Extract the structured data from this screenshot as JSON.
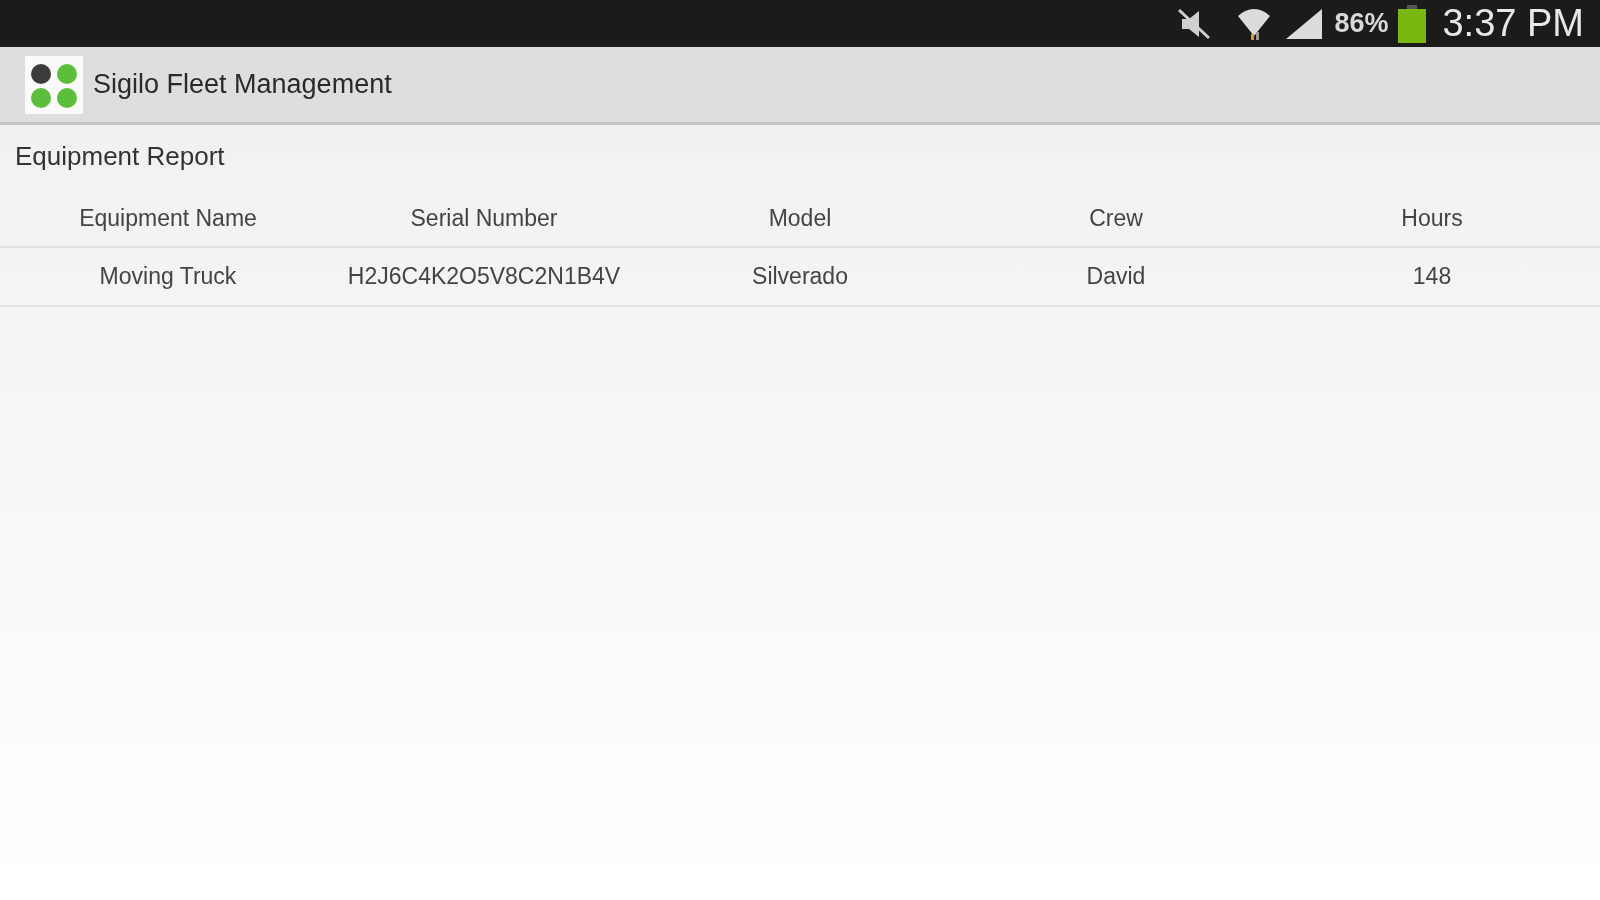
{
  "status_bar": {
    "battery_text": "86%",
    "time": "3:37 PM"
  },
  "app_bar": {
    "title": "Sigilo Fleet Management"
  },
  "report": {
    "title": "Equipment Report",
    "columns": [
      "Equipment Name",
      "Serial Number",
      "Model",
      "Crew",
      "Hours"
    ],
    "rows": [
      [
        "Moving Truck",
        "H2J6C4K2O5V8C2N1B4V",
        "Silverado",
        "David",
        "148"
      ]
    ]
  }
}
